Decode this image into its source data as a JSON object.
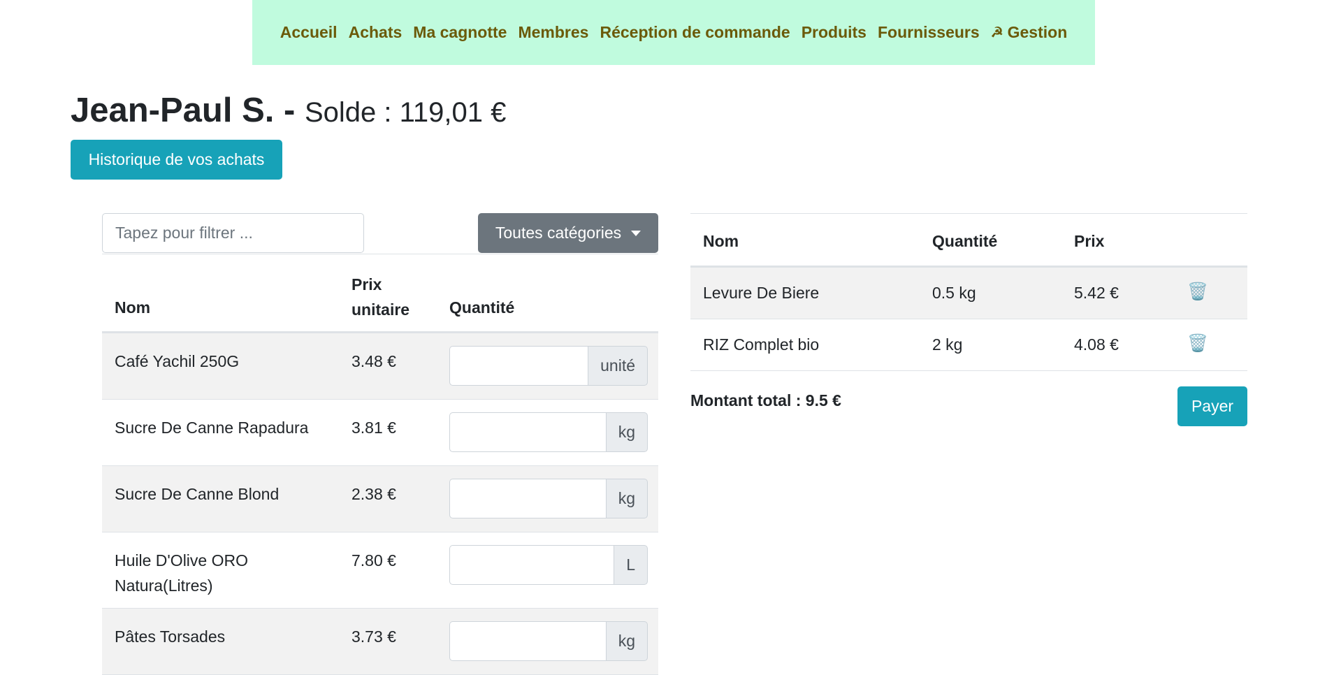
{
  "nav": {
    "items": [
      "Accueil",
      "Achats",
      "Ma cagnotte",
      "Membres",
      "Réception de commande",
      "Produits",
      "Fournisseurs",
      "Gestion"
    ],
    "gestion_icon": "☭"
  },
  "header": {
    "member_name": "Jean-Paul S. -",
    "balance": "Solde : 119,01 €"
  },
  "history_button": "Historique de vos achats",
  "filter": {
    "placeholder": "Tapez pour filtrer ..."
  },
  "category_dropdown": {
    "selected": "Toutes catégories"
  },
  "products_table": {
    "headers": {
      "name": "Nom",
      "unit_price": "Prix unitaire",
      "quantity": "Quantité"
    },
    "rows": [
      {
        "name": "Café Yachil 250G",
        "price": "3.48 €",
        "unit": "unité"
      },
      {
        "name": "Sucre De Canne Rapadura",
        "price": "3.81 €",
        "unit": "kg"
      },
      {
        "name": "Sucre De Canne Blond",
        "price": "2.38 €",
        "unit": "kg"
      },
      {
        "name": "Huile D'Olive ORO Natura(Litres)",
        "price": "7.80 €",
        "unit": "L"
      },
      {
        "name": "Pâtes Torsades",
        "price": "3.73 €",
        "unit": "kg"
      }
    ]
  },
  "cart": {
    "headers": {
      "name": "Nom",
      "quantity": "Quantité",
      "price": "Prix"
    },
    "rows": [
      {
        "name": "Levure De Biere",
        "quantity": "0.5 kg",
        "price": "5.42 €"
      },
      {
        "name": "RIZ Complet bio",
        "quantity": "2 kg",
        "price": "4.08 €"
      }
    ],
    "delete_icon": "🗑️",
    "total": "Montant total : 9.5 €",
    "pay_button": "Payer"
  }
}
